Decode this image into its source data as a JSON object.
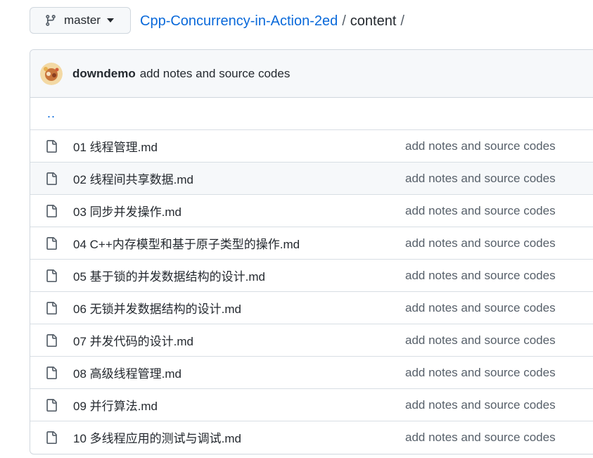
{
  "branch": {
    "name": "master",
    "icon": "git-branch-icon"
  },
  "breadcrumb": {
    "repo": "Cpp-Concurrency-in-Action-2ed",
    "separator": "/",
    "dir": "content"
  },
  "latest_commit": {
    "author": "downdemo",
    "message": "add notes and source codes"
  },
  "parent_link": "..",
  "files": [
    {
      "name": "01 线程管理.md",
      "commit": "add notes and source codes"
    },
    {
      "name": "02 线程间共享数据.md",
      "commit": "add notes and source codes"
    },
    {
      "name": "03 同步并发操作.md",
      "commit": "add notes and source codes"
    },
    {
      "name": "04 C++内存模型和基于原子类型的操作.md",
      "commit": "add notes and source codes"
    },
    {
      "name": "05 基于锁的并发数据结构的设计.md",
      "commit": "add notes and source codes"
    },
    {
      "name": "06 无锁并发数据结构的设计.md",
      "commit": "add notes and source codes"
    },
    {
      "name": "07 并发代码的设计.md",
      "commit": "add notes and source codes"
    },
    {
      "name": "08 高级线程管理.md",
      "commit": "add notes and source codes"
    },
    {
      "name": "09 并行算法.md",
      "commit": "add notes and source codes"
    },
    {
      "name": "10 多线程应用的测试与调试.md",
      "commit": "add notes and source codes"
    }
  ],
  "colors": {
    "link": "#0969da",
    "muted": "#57606a",
    "border": "#d0d7de",
    "header_bg": "#f6f8fa"
  }
}
